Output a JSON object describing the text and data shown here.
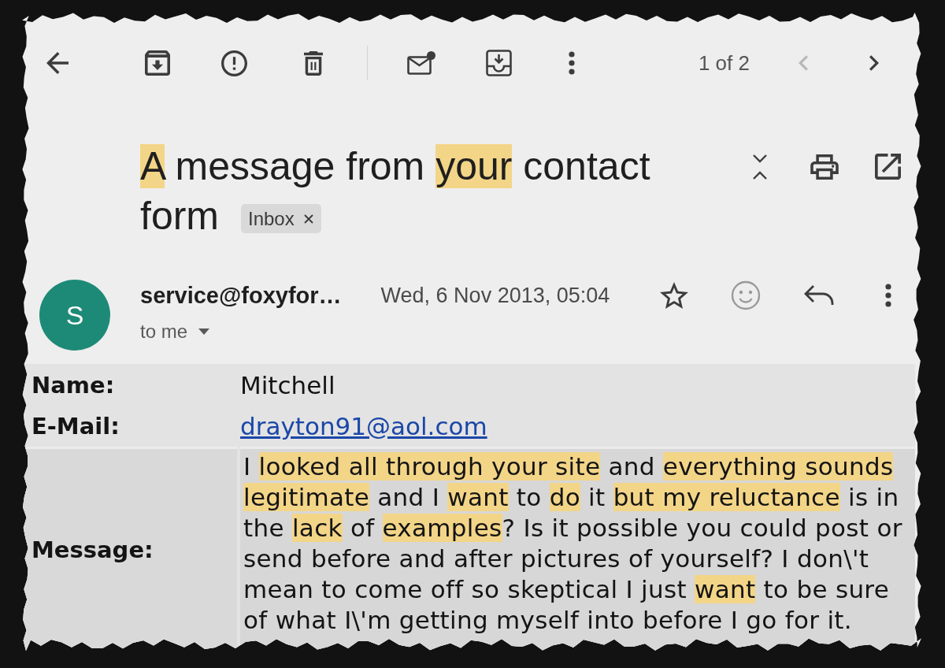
{
  "toolbar": {
    "pager": {
      "label": "1 of 2",
      "previous": {
        "disabled": true
      },
      "next": {
        "disabled": false
      }
    }
  },
  "subject": {
    "segments": [
      {
        "text": "A",
        "highlighted": true
      },
      {
        "text": " message from ",
        "highlighted": false
      },
      {
        "text": "your",
        "highlighted": true
      },
      {
        "text": " contact form",
        "highlighted": false
      }
    ],
    "label": {
      "text": "Inbox"
    }
  },
  "sender": {
    "avatar_letter": "S",
    "address": "service@foxyfor…",
    "date": "Wed, 6 Nov 2013, 05:04",
    "starred": false,
    "recipient": "to me"
  },
  "form_fields": [
    {
      "kind": "text",
      "label": "Name:",
      "value": "Mitchell"
    },
    {
      "kind": "link",
      "label": "E-Mail:",
      "value": "drayton91@aol.com"
    },
    {
      "kind": "message",
      "label": "Message:",
      "segments": [
        {
          "text": "I ",
          "highlighted": false
        },
        {
          "text": "looked all through your site",
          "highlighted": true
        },
        {
          "text": " and ",
          "highlighted": false
        },
        {
          "text": "everything sounds legitimate",
          "highlighted": true
        },
        {
          "text": " and I ",
          "highlighted": false
        },
        {
          "text": "want",
          "highlighted": true
        },
        {
          "text": " to ",
          "highlighted": false
        },
        {
          "text": "do",
          "highlighted": true
        },
        {
          "text": " it ",
          "highlighted": false
        },
        {
          "text": "but my reluctance",
          "highlighted": true
        },
        {
          "text": " is in the ",
          "highlighted": false
        },
        {
          "text": "lack",
          "highlighted": true
        },
        {
          "text": " of ",
          "highlighted": false
        },
        {
          "text": "examples",
          "highlighted": true
        },
        {
          "text": "? Is it possible you could post or send before and after pictures of yourself? I don\\'t mean to come off so skeptical I just ",
          "highlighted": false
        },
        {
          "text": "want",
          "highlighted": true
        },
        {
          "text": " to be sure of what I\\'m getting myself into before I go for it.",
          "highlighted": false
        }
      ]
    }
  ]
}
